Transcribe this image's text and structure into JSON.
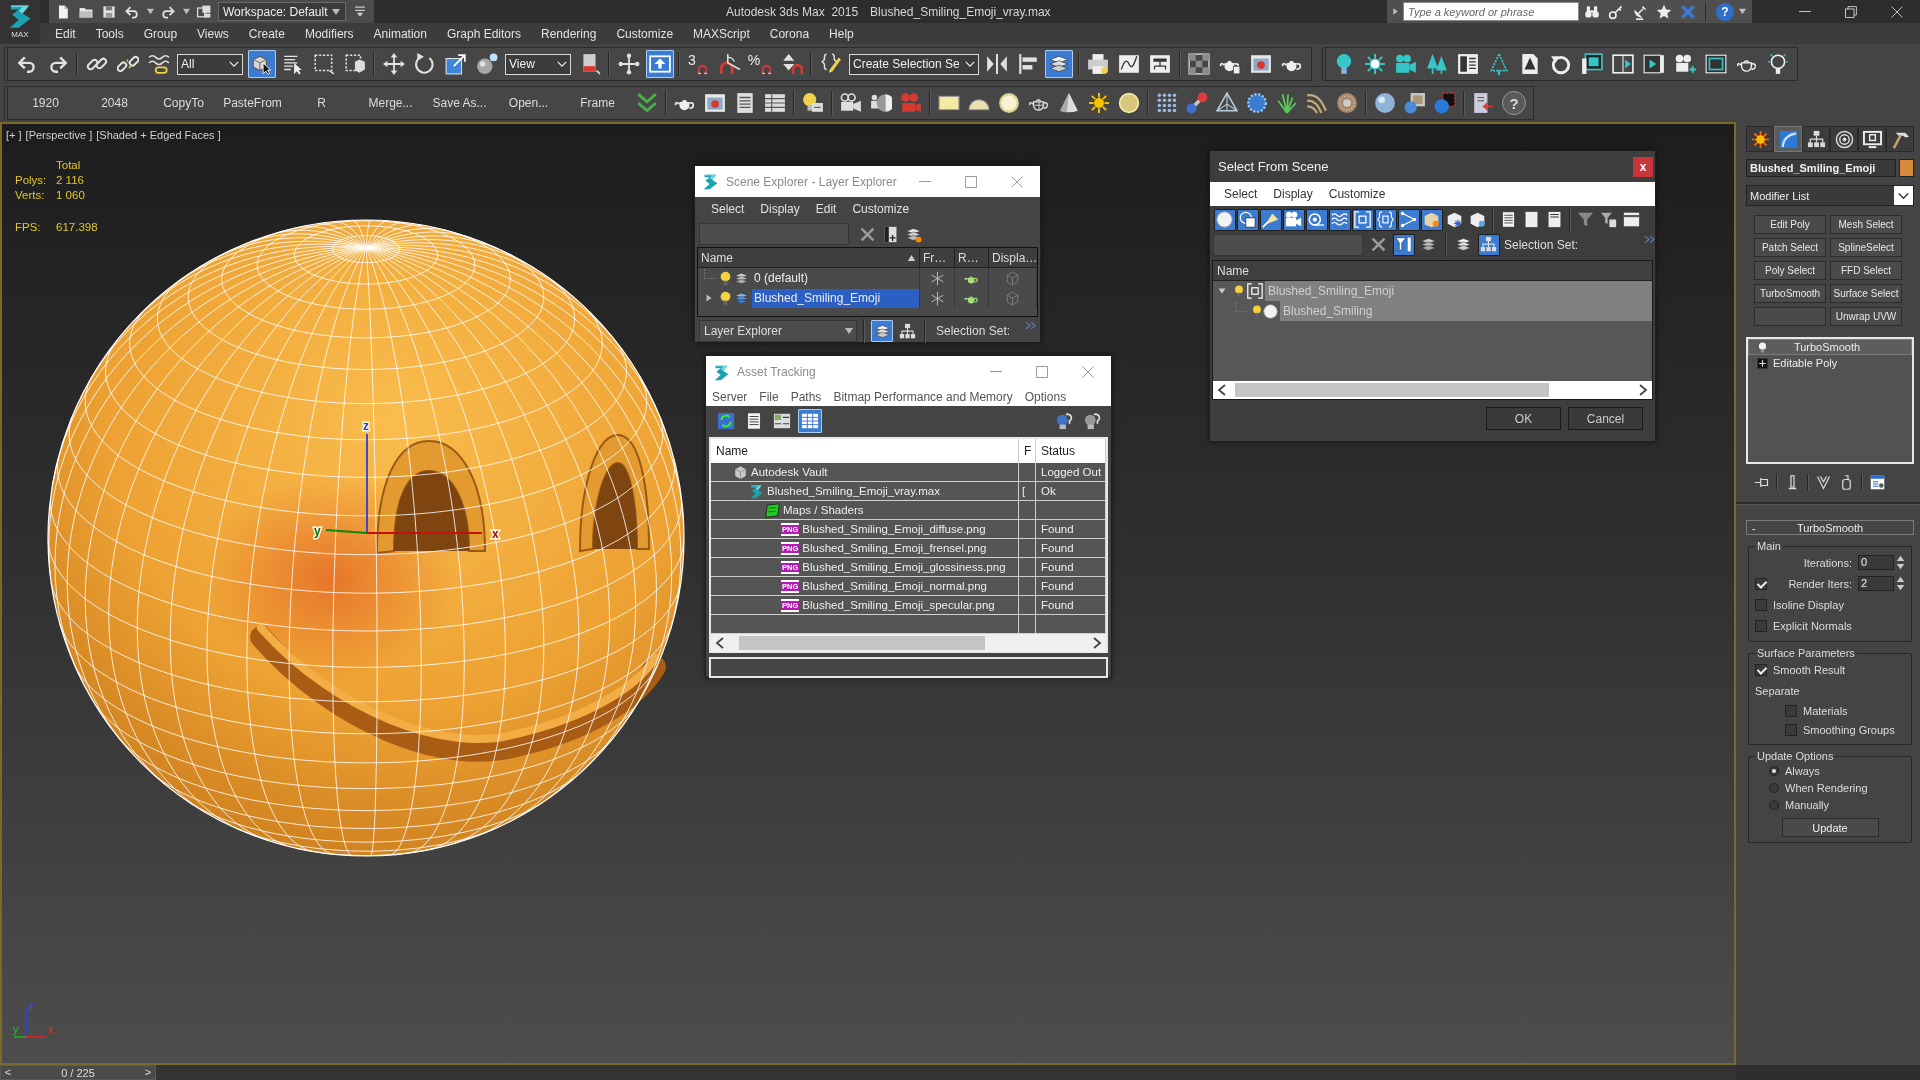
{
  "title_bar": {
    "app_button": "MAX",
    "workspace": "Workspace: Default",
    "app_title": "Autodesk 3ds Max  2015",
    "file_name": "Blushed_Smiling_Emoji_vray.max",
    "search": {
      "placeholder": "Type a keyword or phrase"
    },
    "help": "?"
  },
  "menu_bar": [
    "Edit",
    "Tools",
    "Group",
    "Views",
    "Create",
    "Modifiers",
    "Animation",
    "Graph Editors",
    "Rendering",
    "Customize",
    "MAXScript",
    "Corona",
    "Help"
  ],
  "main_toolbar": {
    "items": [
      {
        "kind": "button",
        "selected": false
      },
      {
        "kind": "button",
        "selected": false
      },
      {
        "kind": "button",
        "selected": false
      },
      {
        "kind": "button",
        "selected": false
      },
      {
        "kind": "button",
        "selected": false
      },
      {
        "kind": "dropdown",
        "value": "All"
      },
      {
        "kind": "button",
        "selected": true
      },
      {
        "kind": "button",
        "selected": false
      },
      {
        "kind": "button",
        "selected": false
      },
      {
        "kind": "button",
        "selected": false
      },
      {
        "kind": "button",
        "selected": false
      },
      {
        "kind": "button",
        "selected": false
      },
      {
        "kind": "button",
        "selected": false
      },
      {
        "kind": "button",
        "selected": false
      },
      {
        "kind": "dropdown",
        "value": "View"
      },
      {
        "kind": "button",
        "selected": false
      },
      {
        "kind": "button",
        "selected": false
      },
      {
        "kind": "button",
        "selected": true
      },
      {
        "kind": "button",
        "label": "3",
        "selected": false
      },
      {
        "kind": "button",
        "selected": false
      },
      {
        "kind": "button",
        "label": "%",
        "selected": false
      },
      {
        "kind": "button",
        "selected": false
      },
      {
        "kind": "button",
        "selected": false
      },
      {
        "kind": "dropdown",
        "value": "Create Selection Se"
      },
      {
        "kind": "button",
        "selected": false
      },
      {
        "kind": "button",
        "selected": false
      },
      {
        "kind": "button",
        "selected": true
      },
      {
        "kind": "button",
        "selected": false
      },
      {
        "kind": "button",
        "selected": false
      },
      {
        "kind": "button",
        "selected": false
      },
      {
        "kind": "button",
        "selected": false
      },
      {
        "kind": "button",
        "selected": false
      },
      {
        "kind": "button",
        "selected": false
      },
      {
        "kind": "button",
        "selected": false
      }
    ]
  },
  "second_toolbar": {
    "buttons": [
      "1920",
      "2048",
      "CopyTo",
      "PasteFrom",
      "R",
      "Merge...",
      "Save As...",
      "Open...",
      "Frame"
    ],
    "help": "?"
  },
  "viewport": {
    "labels": [
      "[+ ]",
      "[Perspective ]",
      "[Shaded + Edged Faces ]"
    ],
    "stats": {
      "header": "Total",
      "rows": [
        {
          "label": "Polys:",
          "value": "2 116"
        },
        {
          "label": "Verts:",
          "value": "1 060"
        }
      ],
      "fps_label": "FPS:",
      "fps_value": "617.398"
    },
    "gizmo_labels": [
      "z",
      "y",
      "x"
    ],
    "axis_tripod_labels": [
      "z",
      "y",
      "x"
    ]
  },
  "scene_explorer": {
    "title": "Scene Explorer - Layer Explorer",
    "menu": [
      "Select",
      "Display",
      "Edit",
      "Customize"
    ],
    "columns": [
      "Name",
      "Fr…",
      "R…",
      "Displa…"
    ],
    "rows": [
      {
        "name": "0 (default)",
        "selected": false
      },
      {
        "name": "Blushed_Smiling_Emoji",
        "selected": true,
        "expanded": false
      }
    ],
    "explorer_mode": "Layer Explorer",
    "mode_buttons": [
      {
        "selected": true
      },
      {
        "selected": false
      }
    ],
    "selection_set_label": "Selection Set:"
  },
  "asset_tracking": {
    "title": "Asset Tracking",
    "menu": [
      "Server",
      "File",
      "Paths",
      "Bitmap Performance and Memory",
      "Options"
    ],
    "view_buttons": [
      {
        "selected": false
      },
      {
        "selected": false
      },
      {
        "selected": false
      },
      {
        "selected": true
      }
    ],
    "columns": [
      "Name",
      "F",
      "Status"
    ],
    "rows": [
      {
        "kind": "vault",
        "name": "Autodesk Vault",
        "status": "Logged Out",
        "children": [
          {
            "kind": "max",
            "name": "Blushed_Smiling_Emoji_vray.max",
            "flag": "[",
            "status": "Ok",
            "children": [
              {
                "kind": "folder",
                "name": "Maps / Shaders",
                "children": [
                  {
                    "kind": "png",
                    "badge": "PNG",
                    "name": "Blushed_Smiling_Emoji_diffuse.png",
                    "status": "Found"
                  },
                  {
                    "kind": "png",
                    "badge": "PNG",
                    "name": "Blushed_Smiling_Emoji_frensel.png",
                    "status": "Found"
                  },
                  {
                    "kind": "png",
                    "badge": "PNG",
                    "name": "Blushed_Smiling_Emoji_glossiness.png",
                    "status": "Found"
                  },
                  {
                    "kind": "png",
                    "badge": "PNG",
                    "name": "Blushed_Smiling_Emoji_normal.png",
                    "status": "Found"
                  },
                  {
                    "kind": "png",
                    "badge": "PNG",
                    "name": "Blushed_Smiling_Emoji_specular.png",
                    "status": "Found"
                  }
                ]
              }
            ]
          }
        ]
      }
    ]
  },
  "select_from_scene": {
    "title": "Select From Scene",
    "close": "x",
    "menu": [
      "Select",
      "Display",
      "Customize"
    ],
    "filters": [
      {
        "selected": true
      },
      {
        "selected": true
      },
      {
        "selected": true
      },
      {
        "selected": true
      },
      {
        "selected": true
      },
      {
        "selected": true
      },
      {
        "selected": true
      },
      {
        "selected": true
      },
      {
        "selected": true
      },
      {
        "selected": true
      },
      {
        "selected": false
      },
      {
        "selected": false
      }
    ],
    "search_tools": [
      {
        "selected": true
      },
      {
        "selected": false
      }
    ],
    "view_buttons": [
      {
        "selected": false
      },
      {
        "selected": true
      }
    ],
    "selection_set_label": "Selection Set:",
    "columns": [
      "Name"
    ],
    "rows": [
      {
        "kind": "group",
        "name": "Blushed_Smiling_Emoji",
        "selected": true,
        "expanded": true,
        "children": [
          {
            "kind": "object",
            "name": "Blushed_Smiling",
            "selected": true
          }
        ]
      }
    ],
    "buttons": [
      "OK",
      "Cancel"
    ]
  },
  "command_panel": {
    "tabs": [
      {
        "selected": false
      },
      {
        "selected": true
      },
      {
        "selected": false
      },
      {
        "selected": false
      },
      {
        "selected": false
      },
      {
        "selected": false
      }
    ],
    "object": {
      "name": "Blushed_Smiling_Emoji",
      "color": "#d8893a"
    },
    "modifier_list": "Modifier List",
    "modifier_buttons": [
      {
        "kind": "set",
        "label": "Edit Poly"
      },
      {
        "kind": "set",
        "label": "Mesh Select"
      },
      {
        "kind": "set",
        "label": "Patch Select"
      },
      {
        "kind": "set",
        "label": "SplineSelect"
      },
      {
        "kind": "set",
        "label": "Poly Select"
      },
      {
        "kind": "set",
        "label": "FFD Select"
      },
      {
        "kind": "set",
        "label": "TurboSmooth"
      },
      {
        "kind": "set",
        "label": "Surface Select"
      },
      {
        "kind": "empty"
      },
      {
        "kind": "set",
        "label": "Unwrap UVW"
      }
    ],
    "stack": [
      {
        "kind": "modifier",
        "label": "TurboSmooth",
        "enabled": true,
        "selected": true
      },
      {
        "kind": "base",
        "label": "Editable Poly",
        "expanded": false,
        "selected": false
      }
    ],
    "rollout": {
      "toggle": "-",
      "title": "TurboSmooth",
      "groups": [
        {
          "title": "Main",
          "controls": [
            {
              "kind": "spinner",
              "label": "Iterations:",
              "value": "0"
            },
            {
              "kind": "spinner",
              "label": "Render Iters:",
              "value": "2",
              "checked": true
            },
            {
              "kind": "checkbox",
              "label": "Isoline Display",
              "checked": false
            },
            {
              "kind": "checkbox",
              "label": "Explicit Normals",
              "checked": false
            }
          ]
        },
        {
          "title": "Surface Parameters",
          "controls": [
            {
              "kind": "checkbox",
              "label": "Smooth Result",
              "checked": true
            },
            {
              "kind": "label",
              "label": "Separate",
              "children": [
                {
                  "kind": "checkbox",
                  "label": "Materials",
                  "checked": false
                },
                {
                  "kind": "checkbox",
                  "label": "Smoothing Groups",
                  "checked": false
                }
              ]
            }
          ]
        },
        {
          "title": "Update Options",
          "controls": [
            {
              "kind": "radio",
              "label": "Always",
              "selected": true
            },
            {
              "kind": "radio",
              "label": "When Rendering",
              "selected": false
            },
            {
              "kind": "radio",
              "label": "Manually",
              "selected": false
            },
            {
              "kind": "button",
              "label": "Update"
            }
          ]
        }
      ]
    }
  },
  "time_slider": {
    "prev": "<",
    "label": "0 / 225",
    "next": ">",
    "level": 0
  }
}
